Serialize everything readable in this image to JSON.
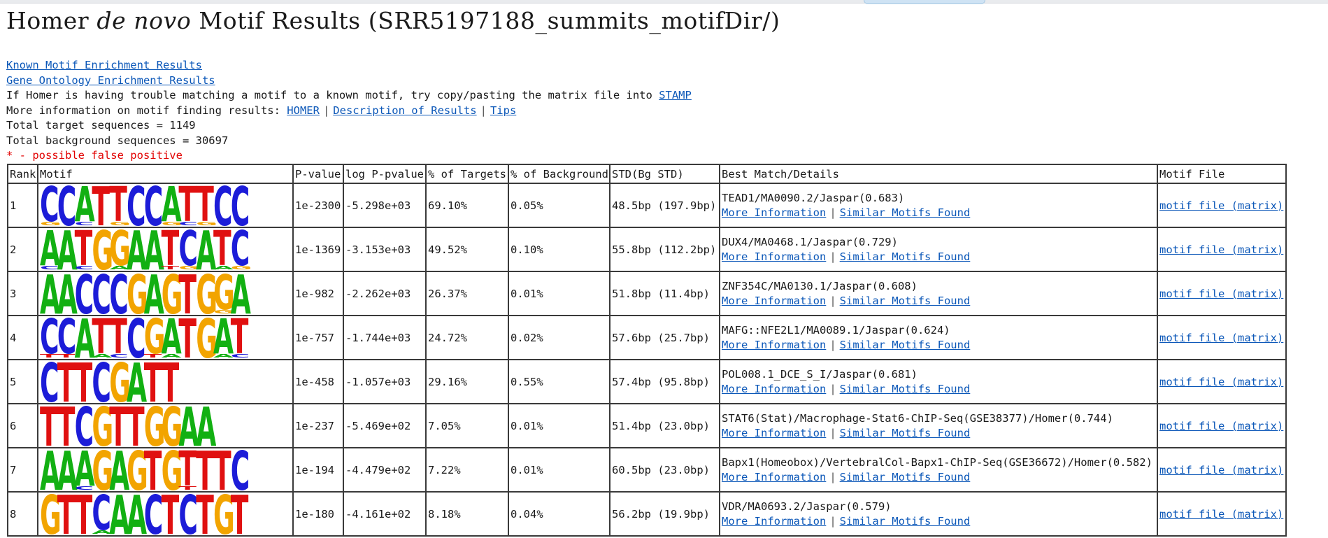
{
  "title": {
    "pre": "Homer ",
    "italic": "de novo",
    "post": " Motif Results (SRR5197188_summits_motifDir/)"
  },
  "links": {
    "known": "Known Motif Enrichment Results",
    "go": "Gene Ontology Enrichment Results"
  },
  "stamp_text": "If Homer is having trouble matching a motif to a known motif, try copy/pasting the matrix file into ",
  "stamp_link": "STAMP",
  "more_info_text": "More information on motif finding results: ",
  "more_info_links": [
    "HOMER",
    "Description of Results",
    "Tips"
  ],
  "separator": "|",
  "total_target": "Total target sequences = 1149",
  "total_background": "Total background sequences = 30697",
  "false_positive_note": "* - possible false positive",
  "table": {
    "headers": [
      "Rank",
      "Motif",
      "P-value",
      "log P-pvalue",
      "% of Targets",
      "% of Background",
      "STD(Bg STD)",
      "Best Match/Details",
      "Motif File"
    ],
    "more_info_label": "More Information",
    "similar_label": "Similar Motifs Found",
    "motif_file_label": "motif file (matrix)",
    "rows": [
      {
        "rank": "1",
        "motif": "CCATTCCATTCC",
        "sub": "G.C.G..GCG.",
        "pvalue": "1e-2300",
        "logp": "-5.298e+03",
        "targets": "69.10%",
        "background": "0.05%",
        "std": "48.5bp (197.9bp)",
        "best": "TEAD1/MA0090.2/Jaspar(0.683)"
      },
      {
        "rank": "2",
        "motif": "AATGGAATCATC",
        "sub": "C.C.A..TG.AG",
        "pvalue": "1e-1369",
        "logp": "-3.153e+03",
        "targets": "49.52%",
        "background": "0.10%",
        "std": "55.8bp (112.2bp)",
        "best": "DUX4/MA0468.1/Jaspar(0.729)"
      },
      {
        "rank": "3",
        "motif": "AACCCGAGTGGA",
        "sub": "..........G.",
        "pvalue": "1e-982",
        "logp": "-2.262e+03",
        "targets": "26.37%",
        "background": "0.01%",
        "std": "51.8bp (11.4bp)",
        "best": "ZNF354C/MA0130.1/Jaspar(0.608)"
      },
      {
        "rank": "4",
        "motif": "CCATTCGATGAT",
        "sub": "TT.AC.TA..AC",
        "pvalue": "1e-757",
        "logp": "-1.744e+03",
        "targets": "24.72%",
        "background": "0.02%",
        "std": "57.6bp (25.7bp)",
        "best": "MAFG::NFE2L1/MA0089.1/Jaspar(0.624)"
      },
      {
        "rank": "5",
        "motif": "CTTCGATT",
        "sub": "",
        "pvalue": "1e-458",
        "logp": "-1.057e+03",
        "targets": "29.16%",
        "background": "0.55%",
        "std": "57.4bp (95.8bp)",
        "best": "POL008.1_DCE_S_I/Jaspar(0.681)"
      },
      {
        "rank": "6",
        "motif": "TTCGTTGGAA",
        "sub": "",
        "pvalue": "1e-237",
        "logp": "-5.469e+02",
        "targets": "7.05%",
        "background": "0.01%",
        "std": "51.4bp (23.0bp)",
        "best": "STAT6(Stat)/Macrophage-Stat6-ChIP-Seq(GSE38377)/Homer(0.744)"
      },
      {
        "rank": "7",
        "motif": "AAAGAGTGTTTC",
        "sub": "..C.....T...",
        "pvalue": "1e-194",
        "logp": "-4.479e+02",
        "targets": "7.22%",
        "background": "0.01%",
        "std": "60.5bp (23.0bp)",
        "best": "Bapx1(Homeobox)/VertebralCol-Bapx1-ChIP-Seq(GSE36672)/Homer(0.582)"
      },
      {
        "rank": "8",
        "motif": "GTTCAACTCTGT",
        "sub": "...A........",
        "pvalue": "1e-180",
        "logp": "-4.161e+02",
        "targets": "8.18%",
        "background": "0.04%",
        "std": "56.2bp (19.9bp)",
        "best": "VDR/MA0693.2/Jaspar(0.579)"
      }
    ]
  },
  "colors": {
    "A": "#12b012",
    "C": "#1c1cd8",
    "G": "#f2a400",
    "T": "#e01010",
    "link": "#0b57b8",
    "false_positive": "#e20000"
  }
}
